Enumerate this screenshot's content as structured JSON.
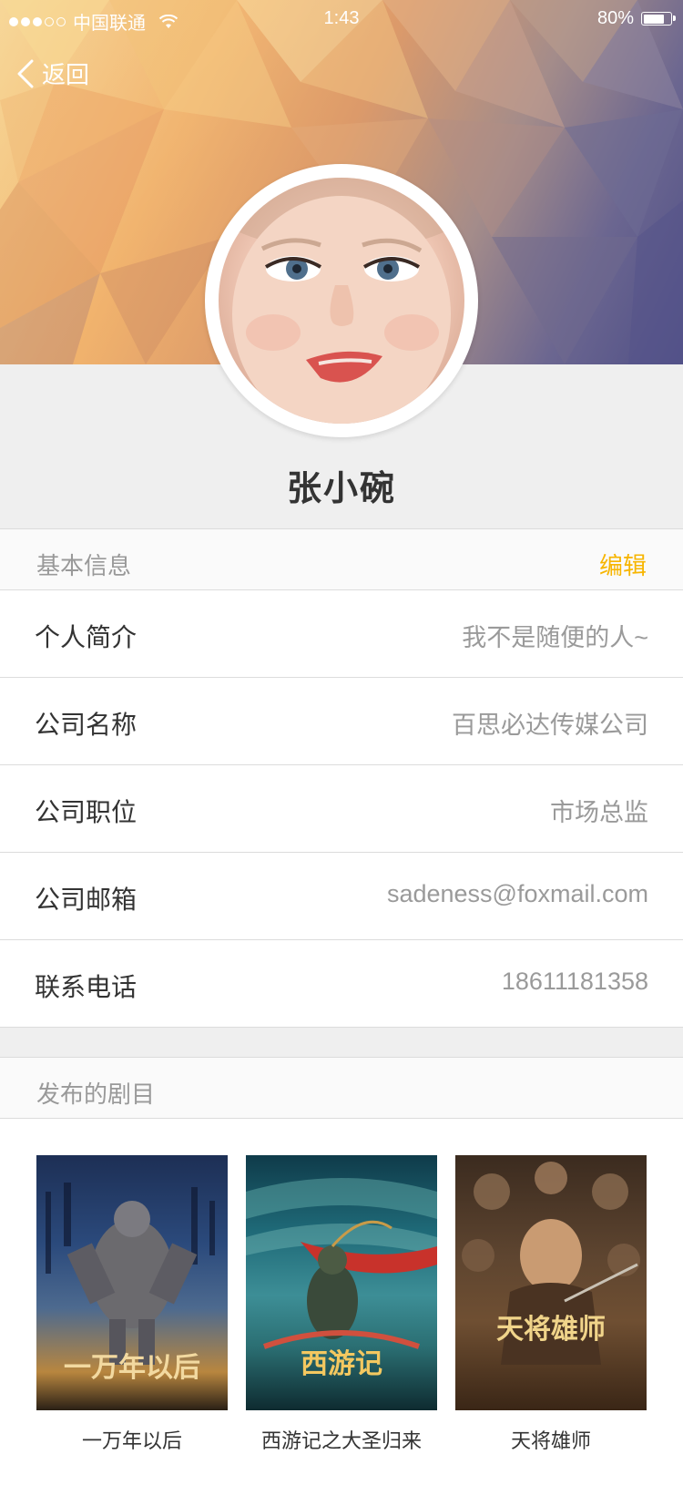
{
  "status_bar": {
    "carrier": "中国联通",
    "time": "1:43",
    "battery": "80%",
    "battery_level": 0.8
  },
  "nav": {
    "back_label": "返回"
  },
  "profile": {
    "name": "张小碗"
  },
  "basic_info": {
    "title": "基本信息",
    "edit_label": "编辑",
    "rows": [
      {
        "label": "个人简介",
        "value": "我不是随便的人~"
      },
      {
        "label": "公司名称",
        "value": "百思必达传媒公司"
      },
      {
        "label": "公司职位",
        "value": "市场总监"
      },
      {
        "label": "公司邮箱",
        "value": "sadeness@foxmail.com"
      },
      {
        "label": "联系电话",
        "value": "18611181358"
      }
    ]
  },
  "works": {
    "title": "发布的剧目",
    "items": [
      {
        "title": "一万年以后",
        "poster_text": "一万年以后"
      },
      {
        "title": "西游记之大圣归来",
        "poster_text": "西游记"
      },
      {
        "title": "天将雄师",
        "poster_text": "天将雄师"
      }
    ]
  },
  "colors": {
    "accent": "#f7b500",
    "page_bg": "#efefef",
    "label": "#333333",
    "value": "#9a9a9a"
  }
}
